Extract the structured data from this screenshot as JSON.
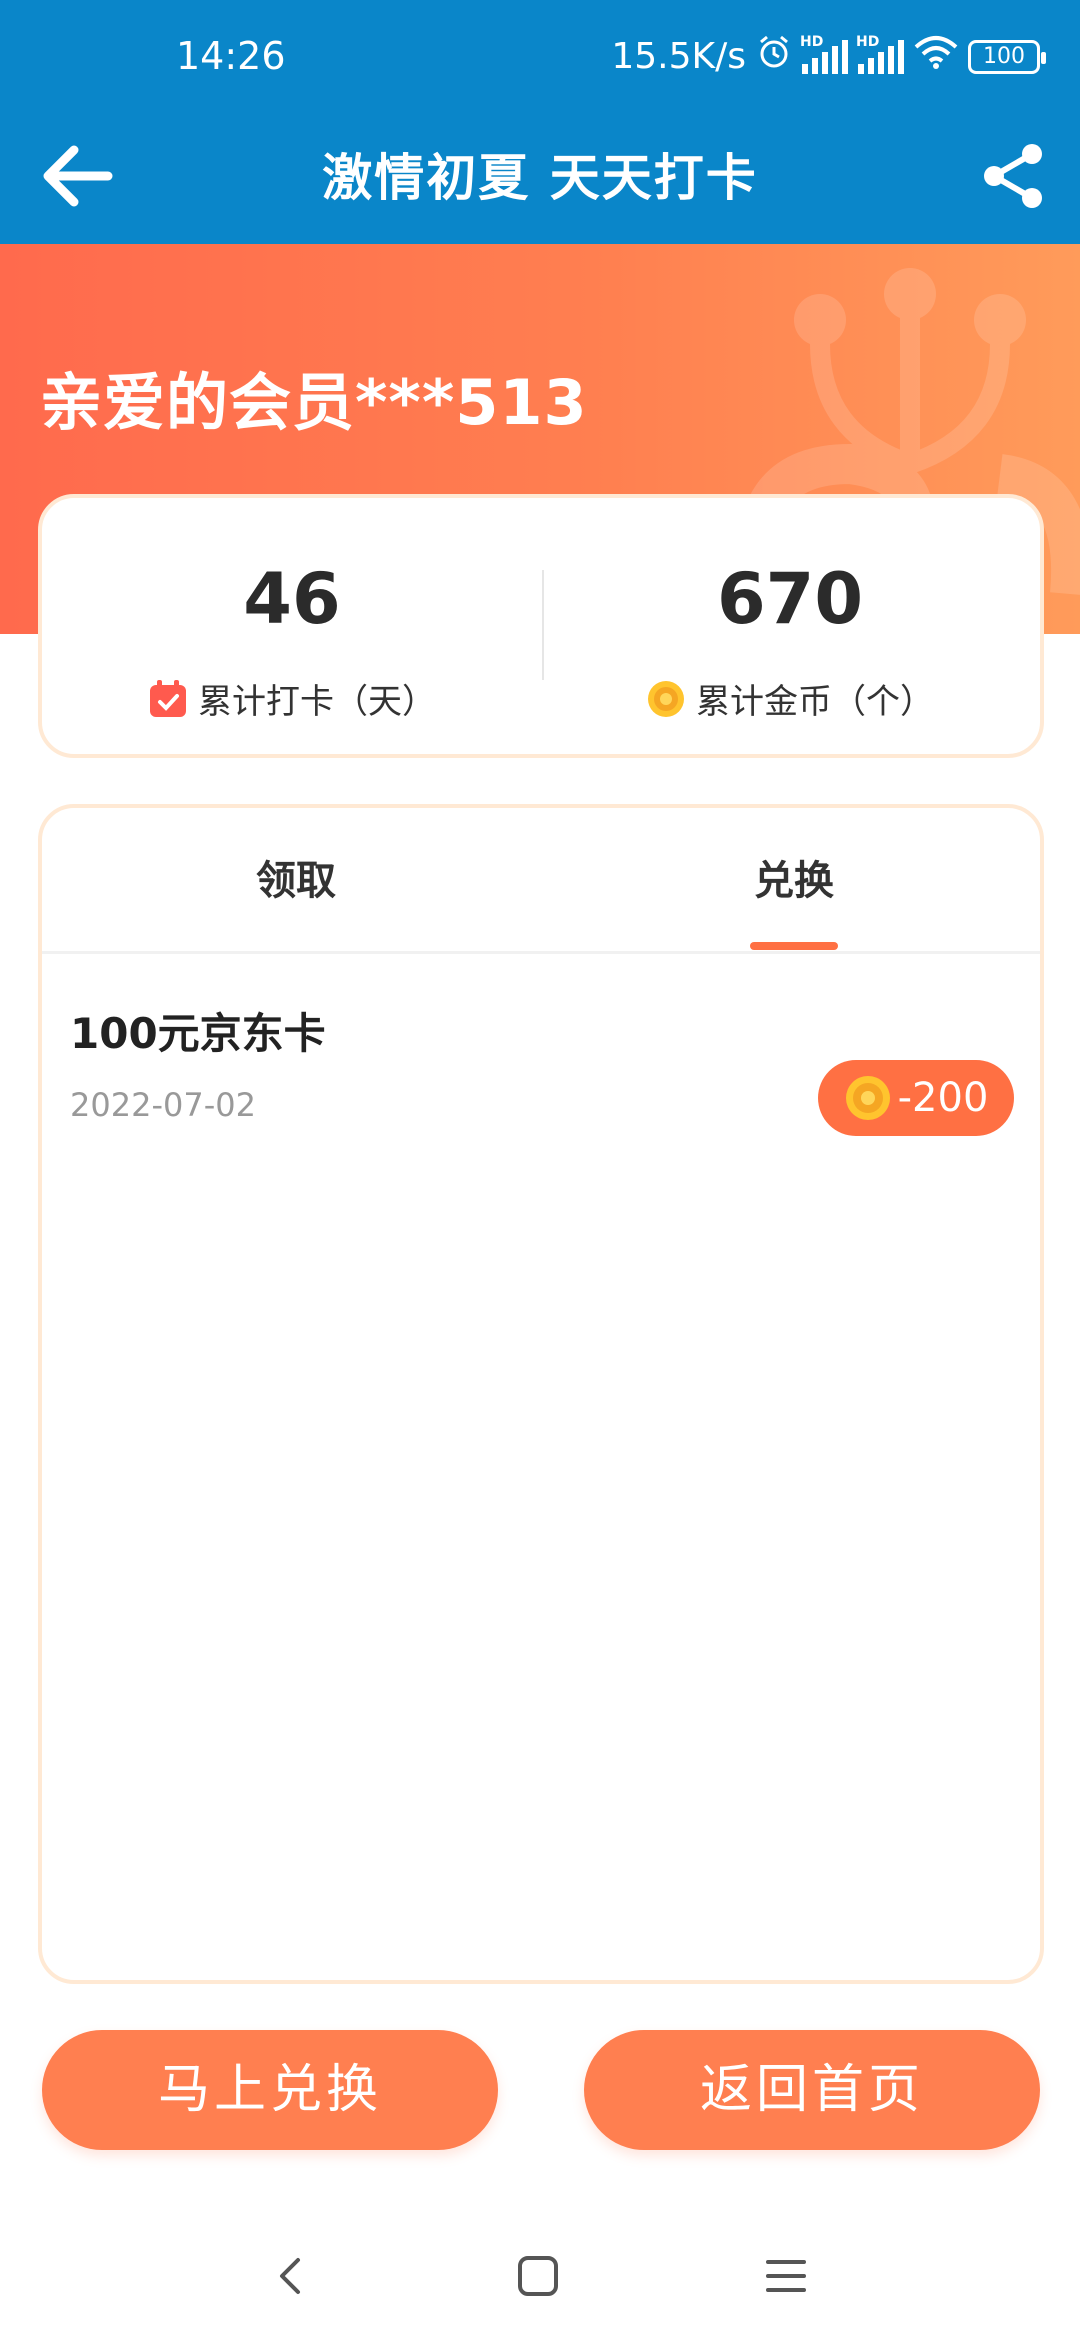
{
  "status_bar": {
    "time": "14:26",
    "network_speed": "15.5K/s",
    "signal1_label": "HD",
    "signal2_label": "HD",
    "battery": "100",
    "icons": [
      "alarm-icon",
      "signal-icon",
      "signal-icon",
      "wifi-icon",
      "battery-icon"
    ]
  },
  "nav": {
    "title": "激情初夏 天天打卡",
    "back_icon": "back-arrow-icon",
    "share_icon": "share-icon"
  },
  "hero": {
    "greeting": "亲爱的会员***513"
  },
  "stats": {
    "checkin_days": "46",
    "checkin_label": "累计打卡（天）",
    "coins": "670",
    "coins_label": "累计金币（个）"
  },
  "tabs": [
    {
      "label": "领取",
      "active": false
    },
    {
      "label": "兑换",
      "active": true
    }
  ],
  "records": [
    {
      "title": "100元京东卡",
      "date": "2022-07-02",
      "amount": "-200"
    }
  ],
  "buttons": {
    "redeem_now": "马上兑换",
    "back_home": "返回首页"
  },
  "colors": {
    "header_blue": "#0a86c9",
    "accent_orange": "#ff7043",
    "button_orange": "#ff7f50",
    "card_border": "#ffe9d4"
  }
}
